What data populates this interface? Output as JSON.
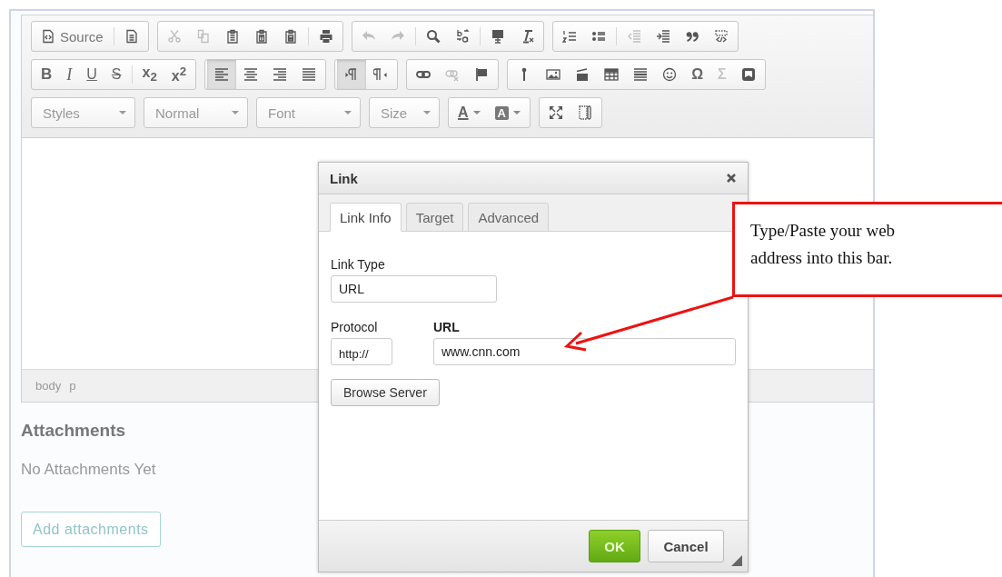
{
  "toolbar": {
    "rows": [
      [
        {
          "kind": "buttons",
          "items": [
            {
              "kind": "icon-text",
              "label": "Source",
              "disabled": false,
              "selected": false
            },
            {
              "kind": "separator"
            },
            {
              "kind": "icon",
              "disabled": false,
              "selected": false
            }
          ]
        },
        {
          "kind": "buttons",
          "items": [
            {
              "kind": "icon",
              "disabled": true,
              "selected": false
            },
            {
              "kind": "icon",
              "disabled": true,
              "selected": false
            },
            {
              "kind": "icon",
              "disabled": false,
              "selected": false
            },
            {
              "kind": "icon",
              "disabled": false,
              "selected": false
            },
            {
              "kind": "icon",
              "disabled": false,
              "selected": false
            },
            {
              "kind": "separator"
            },
            {
              "kind": "icon",
              "disabled": false,
              "selected": false
            }
          ]
        },
        {
          "kind": "buttons",
          "items": [
            {
              "kind": "icon",
              "disabled": true,
              "selected": false
            },
            {
              "kind": "icon",
              "disabled": true,
              "selected": false
            },
            {
              "kind": "separator"
            },
            {
              "kind": "icon",
              "disabled": false,
              "selected": false
            },
            {
              "kind": "icon",
              "disabled": false,
              "selected": false
            },
            {
              "kind": "separator"
            },
            {
              "kind": "icon",
              "disabled": false,
              "selected": false
            },
            {
              "kind": "icon",
              "disabled": false,
              "selected": false
            }
          ]
        },
        {
          "kind": "buttons",
          "items": [
            {
              "kind": "icon",
              "disabled": false,
              "selected": false
            },
            {
              "kind": "icon",
              "disabled": false,
              "selected": false
            },
            {
              "kind": "separator"
            },
            {
              "kind": "icon",
              "disabled": true,
              "selected": false
            },
            {
              "kind": "icon",
              "disabled": false,
              "selected": false
            },
            {
              "kind": "icon",
              "disabled": false,
              "selected": false
            },
            {
              "kind": "icon",
              "disabled": false,
              "selected": false
            }
          ]
        }
      ],
      [
        {
          "kind": "buttons",
          "items": [
            {
              "kind": "bold",
              "label": "B",
              "disabled": false,
              "selected": false
            },
            {
              "kind": "italic",
              "label": "I",
              "disabled": false,
              "selected": false
            },
            {
              "kind": "underline",
              "label": "U",
              "disabled": false,
              "selected": false
            },
            {
              "kind": "strike",
              "label": "S",
              "disabled": false,
              "selected": false
            },
            {
              "kind": "separator"
            },
            {
              "kind": "text",
              "label": "x$_{2}$",
              "disabled": false,
              "selected": false
            },
            {
              "kind": "text",
              "label": "x$^{2}$",
              "disabled": false,
              "selected": false
            }
          ]
        },
        {
          "kind": "buttons",
          "items": [
            {
              "kind": "icon",
              "disabled": false,
              "selected": true
            },
            {
              "kind": "icon",
              "disabled": false,
              "selected": false
            },
            {
              "kind": "icon",
              "disabled": false,
              "selected": false
            },
            {
              "kind": "icon",
              "disabled": false,
              "selected": false
            }
          ]
        },
        {
          "kind": "buttons",
          "items": [
            {
              "kind": "icon",
              "disabled": false,
              "selected": true
            },
            {
              "kind": "icon",
              "disabled": false,
              "selected": false
            }
          ]
        },
        {
          "kind": "buttons",
          "items": [
            {
              "kind": "icon",
              "disabled": false,
              "selected": false
            },
            {
              "kind": "icon",
              "disabled": true,
              "selected": false
            },
            {
              "kind": "icon",
              "disabled": false,
              "selected": false
            }
          ]
        },
        {
          "kind": "buttons",
          "items": [
            {
              "kind": "icon",
              "disabled": false,
              "selected": false
            },
            {
              "kind": "icon",
              "disabled": false,
              "selected": false
            },
            {
              "kind": "icon",
              "disabled": false,
              "selected": false
            },
            {
              "kind": "icon",
              "disabled": false,
              "selected": false
            },
            {
              "kind": "icon",
              "disabled": false,
              "selected": false
            },
            {
              "kind": "icon",
              "disabled": false,
              "selected": false
            },
            {
              "kind": "text",
              "label": "Ω",
              "disabled": false,
              "selected": false
            },
            {
              "kind": "text",
              "label": "Σ",
              "disabled": true,
              "selected": false
            },
            {
              "kind": "icon",
              "disabled": false,
              "selected": false
            }
          ]
        }
      ],
      [
        {
          "kind": "combo",
          "label": "Styles"
        },
        {
          "kind": "combo",
          "label": "Normal"
        },
        {
          "kind": "combo",
          "label": "Font"
        },
        {
          "kind": "combo",
          "label": "Size"
        },
        {
          "kind": "buttons",
          "items": [
            {
              "kind": "text-color",
              "label": "A",
              "disabled": false,
              "selected": false
            },
            {
              "kind": "bg-color",
              "label": "A",
              "disabled": false,
              "selected": false
            }
          ]
        },
        {
          "kind": "buttons",
          "items": [
            {
              "kind": "icon",
              "disabled": false,
              "selected": false
            },
            {
              "kind": "icon",
              "disabled": false,
              "selected": false
            }
          ]
        }
      ]
    ]
  },
  "element_path": [
    "body",
    "p"
  ],
  "attachments": {
    "heading": "Attachments",
    "empty_text": "No Attachments Yet",
    "button": "Add attachments"
  },
  "dialog": {
    "title": "Link",
    "tabs": [
      {
        "label": "Link Info",
        "selected": true
      },
      {
        "label": "Target",
        "selected": false
      },
      {
        "label": "Advanced",
        "selected": false
      }
    ],
    "link_type": {
      "label": "Link Type",
      "value": "URL"
    },
    "protocol": {
      "label": "Protocol",
      "value": "http://"
    },
    "url": {
      "label": "URL",
      "value": "www.cnn.com"
    },
    "browse_button": "Browse Server",
    "buttons": [
      {
        "label": "OK",
        "kind": "primary"
      },
      {
        "label": "Cancel",
        "kind": "secondary"
      }
    ]
  },
  "callout": {
    "text": "Type/Paste your web address into this bar."
  }
}
